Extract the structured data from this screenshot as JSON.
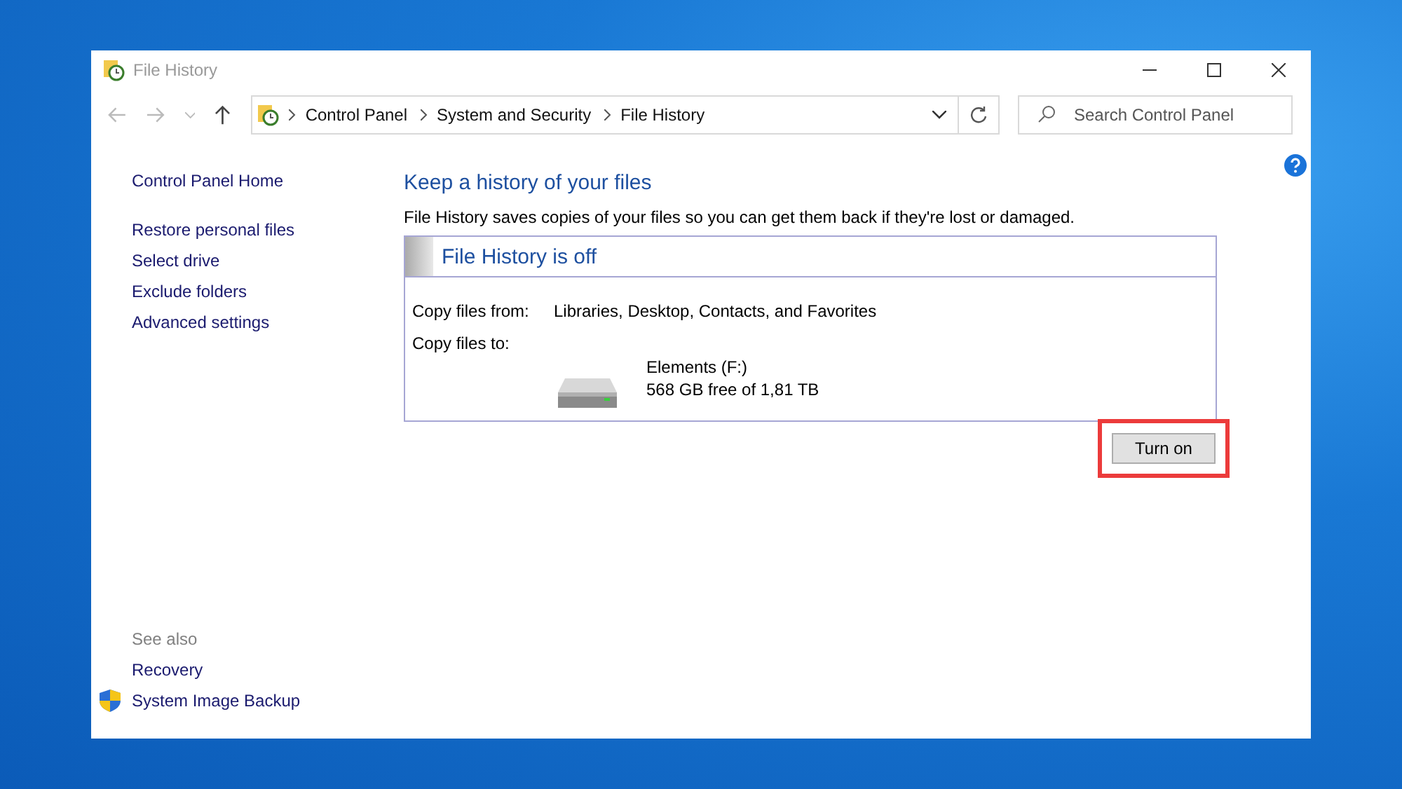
{
  "window": {
    "title": "File History"
  },
  "address_bar": {
    "breadcrumb": [
      "Control Panel",
      "System and Security",
      "File History"
    ]
  },
  "search": {
    "placeholder": "Search Control Panel"
  },
  "sidebar": {
    "home": "Control Panel Home",
    "items": [
      "Restore personal files",
      "Select drive",
      "Exclude folders",
      "Advanced settings"
    ],
    "see_also": {
      "heading": "See also",
      "links": [
        {
          "label": "Recovery",
          "kind": "link"
        },
        {
          "label": "System Image Backup",
          "kind": "shield"
        }
      ]
    }
  },
  "main": {
    "heading": "Keep a history of your files",
    "description": "File History saves copies of your files so you can get them back if they're lost or damaged.",
    "status_panel": {
      "title": "File History is off",
      "copy_from_label": "Copy files from:",
      "copy_from_value": "Libraries, Desktop, Contacts, and Favorites",
      "copy_to_label": "Copy files to:",
      "drive_name": "Elements (F:)",
      "drive_space": "568 GB free of 1,81 TB"
    },
    "button": {
      "label": "Turn on",
      "highlighted": true
    }
  }
}
